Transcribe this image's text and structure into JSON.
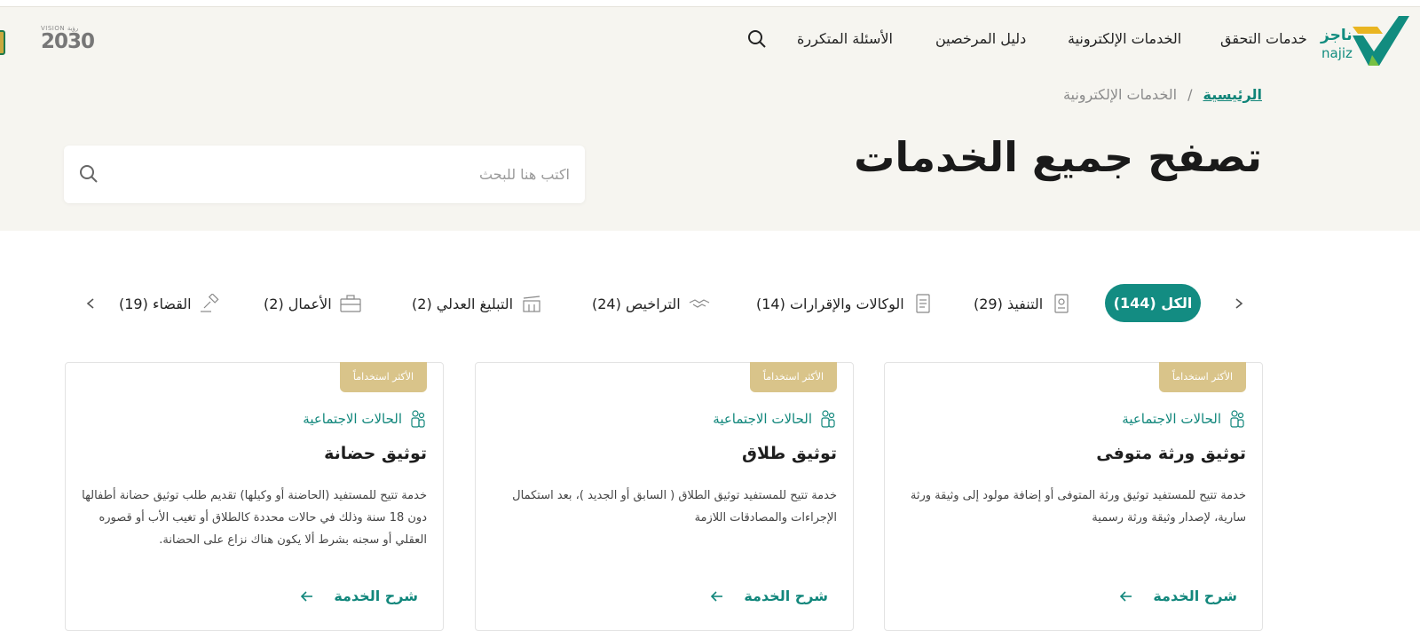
{
  "header": {
    "logo": {
      "ar": "ناجز",
      "en": "najiz"
    },
    "nav": [
      {
        "label": "خدمات التحقق"
      },
      {
        "label": "الخدمات الإلكترونية"
      },
      {
        "label": "دليل المرخصين"
      },
      {
        "label": "الأسئلة المتكررة"
      }
    ],
    "vision": {
      "top": "VISION رؤية",
      "year": "2030"
    }
  },
  "breadcrumb": {
    "home": "الرئيسية",
    "separator": "/",
    "current": "الخدمات الإلكترونية"
  },
  "page_title": "تصفح جميع الخدمات",
  "search": {
    "placeholder": "اكتب هنا للبحث",
    "value": ""
  },
  "tabs": [
    {
      "label": "الكل (144)",
      "active": true
    },
    {
      "label": "التنفيذ (29)",
      "icon": "document-seal-icon"
    },
    {
      "label": "الوكالات والإقرارات (14)",
      "icon": "document-list-icon"
    },
    {
      "label": "التراخيص (24)",
      "icon": "handshake-icon"
    },
    {
      "label": "التبليغ العدلي (2)",
      "icon": "building-icon"
    },
    {
      "label": "الأعمال (2)",
      "icon": "briefcase-icon"
    },
    {
      "label": "القضاء (19)",
      "icon": "gavel-icon"
    }
  ],
  "cards": [
    {
      "badge": "الأكثر استخداماً",
      "category": "الحالات الاجتماعية",
      "title": "توثيق ورثة متوفى",
      "description": "خدمة تتيح للمستفيد توثيق ورثة المتوفى أو إضافة مولود إلى وثيقة ورثة سارية، لإصدار وثيقة ورثة رسمية",
      "more": "شرح الخدمة"
    },
    {
      "badge": "الأكثر استخداماً",
      "category": "الحالات الاجتماعية",
      "title": "توثيق طلاق",
      "description": "خدمة تتيح للمستفيد توثيق الطلاق ( السابق أو الجديد )، بعد استكمال الإجراءات والمصادقات اللازمة",
      "more": "شرح الخدمة"
    },
    {
      "badge": "الأكثر استخداماً",
      "category": "الحالات الاجتماعية",
      "title": "توثيق حضانة",
      "description": "خدمة تتيح للمستفيد (الحاضنة أو وكيلها) تقديم طلب توثيق حضانة أطفالها دون 18 سنة وذلك في حالات محددة كالطلاق أو تغيب الأب أو قصوره العقلي أو سجنه بشرط ألا يكون هناك نزاع على الحضانة.",
      "more": "شرح الخدمة"
    }
  ],
  "colors": {
    "primary": "#138c82",
    "badge": "#d9c48a",
    "hero_bg": "#f6f5f0"
  }
}
